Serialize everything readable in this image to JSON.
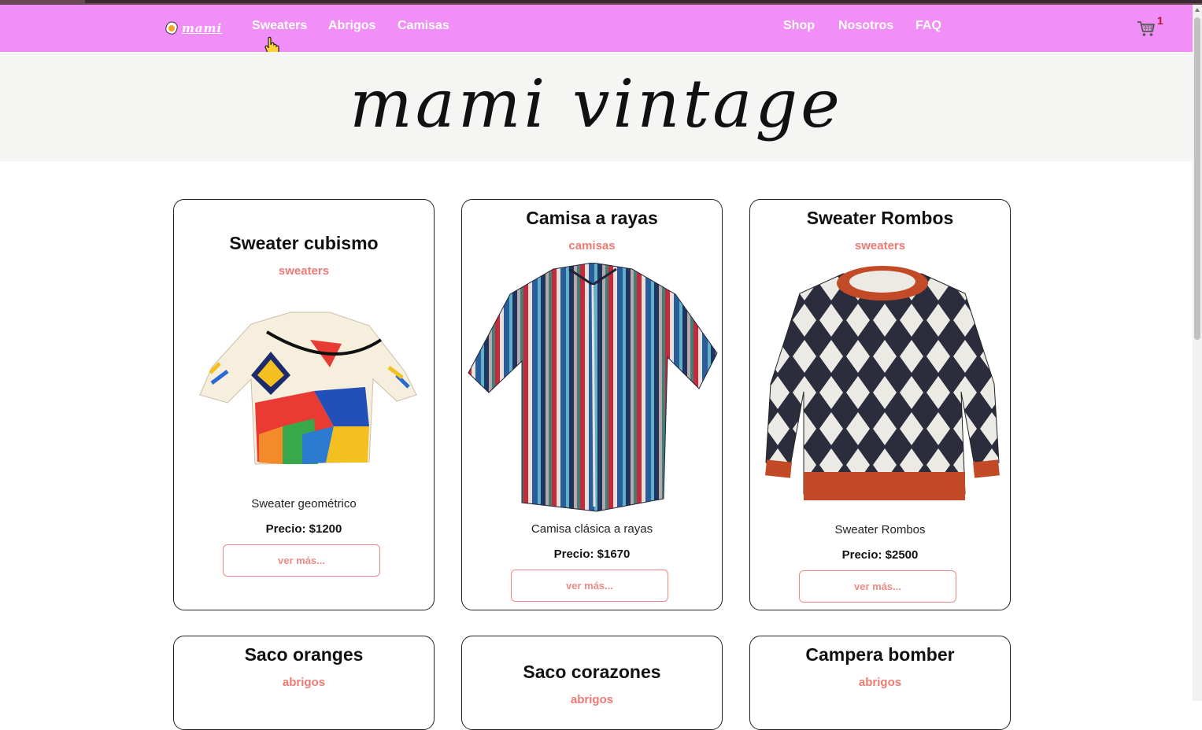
{
  "nav": {
    "brand": "mami",
    "left_links": [
      "Sweaters",
      "Abrigos",
      "Camisas"
    ],
    "right_links": [
      "Shop",
      "Nosotros",
      "FAQ"
    ],
    "cart_count": "1",
    "cart_icon": "cart-icon"
  },
  "hero": {
    "title": "mami vintage"
  },
  "products": [
    {
      "title": "Sweater cubismo",
      "category": "sweaters",
      "description": "Sweater geométrico",
      "price": "Precio: $1200",
      "button": "ver más..."
    },
    {
      "title": "Camisa a rayas",
      "category": "camisas",
      "description": "Camisa clásica a rayas",
      "price": "Precio: $1670",
      "button": "ver más..."
    },
    {
      "title": "Sweater Rombos",
      "category": "sweaters",
      "description": "Sweater Rombos",
      "price": "Precio: $2500",
      "button": "ver más..."
    },
    {
      "title": "Saco oranges",
      "category": "abrigos"
    },
    {
      "title": "Saco corazones",
      "category": "abrigos"
    },
    {
      "title": "Campera bomber",
      "category": "abrigos"
    }
  ],
  "colors": {
    "navbar": "#f18ef8",
    "accent": "#ee7a74",
    "hero_bg": "#f5f5f4"
  }
}
